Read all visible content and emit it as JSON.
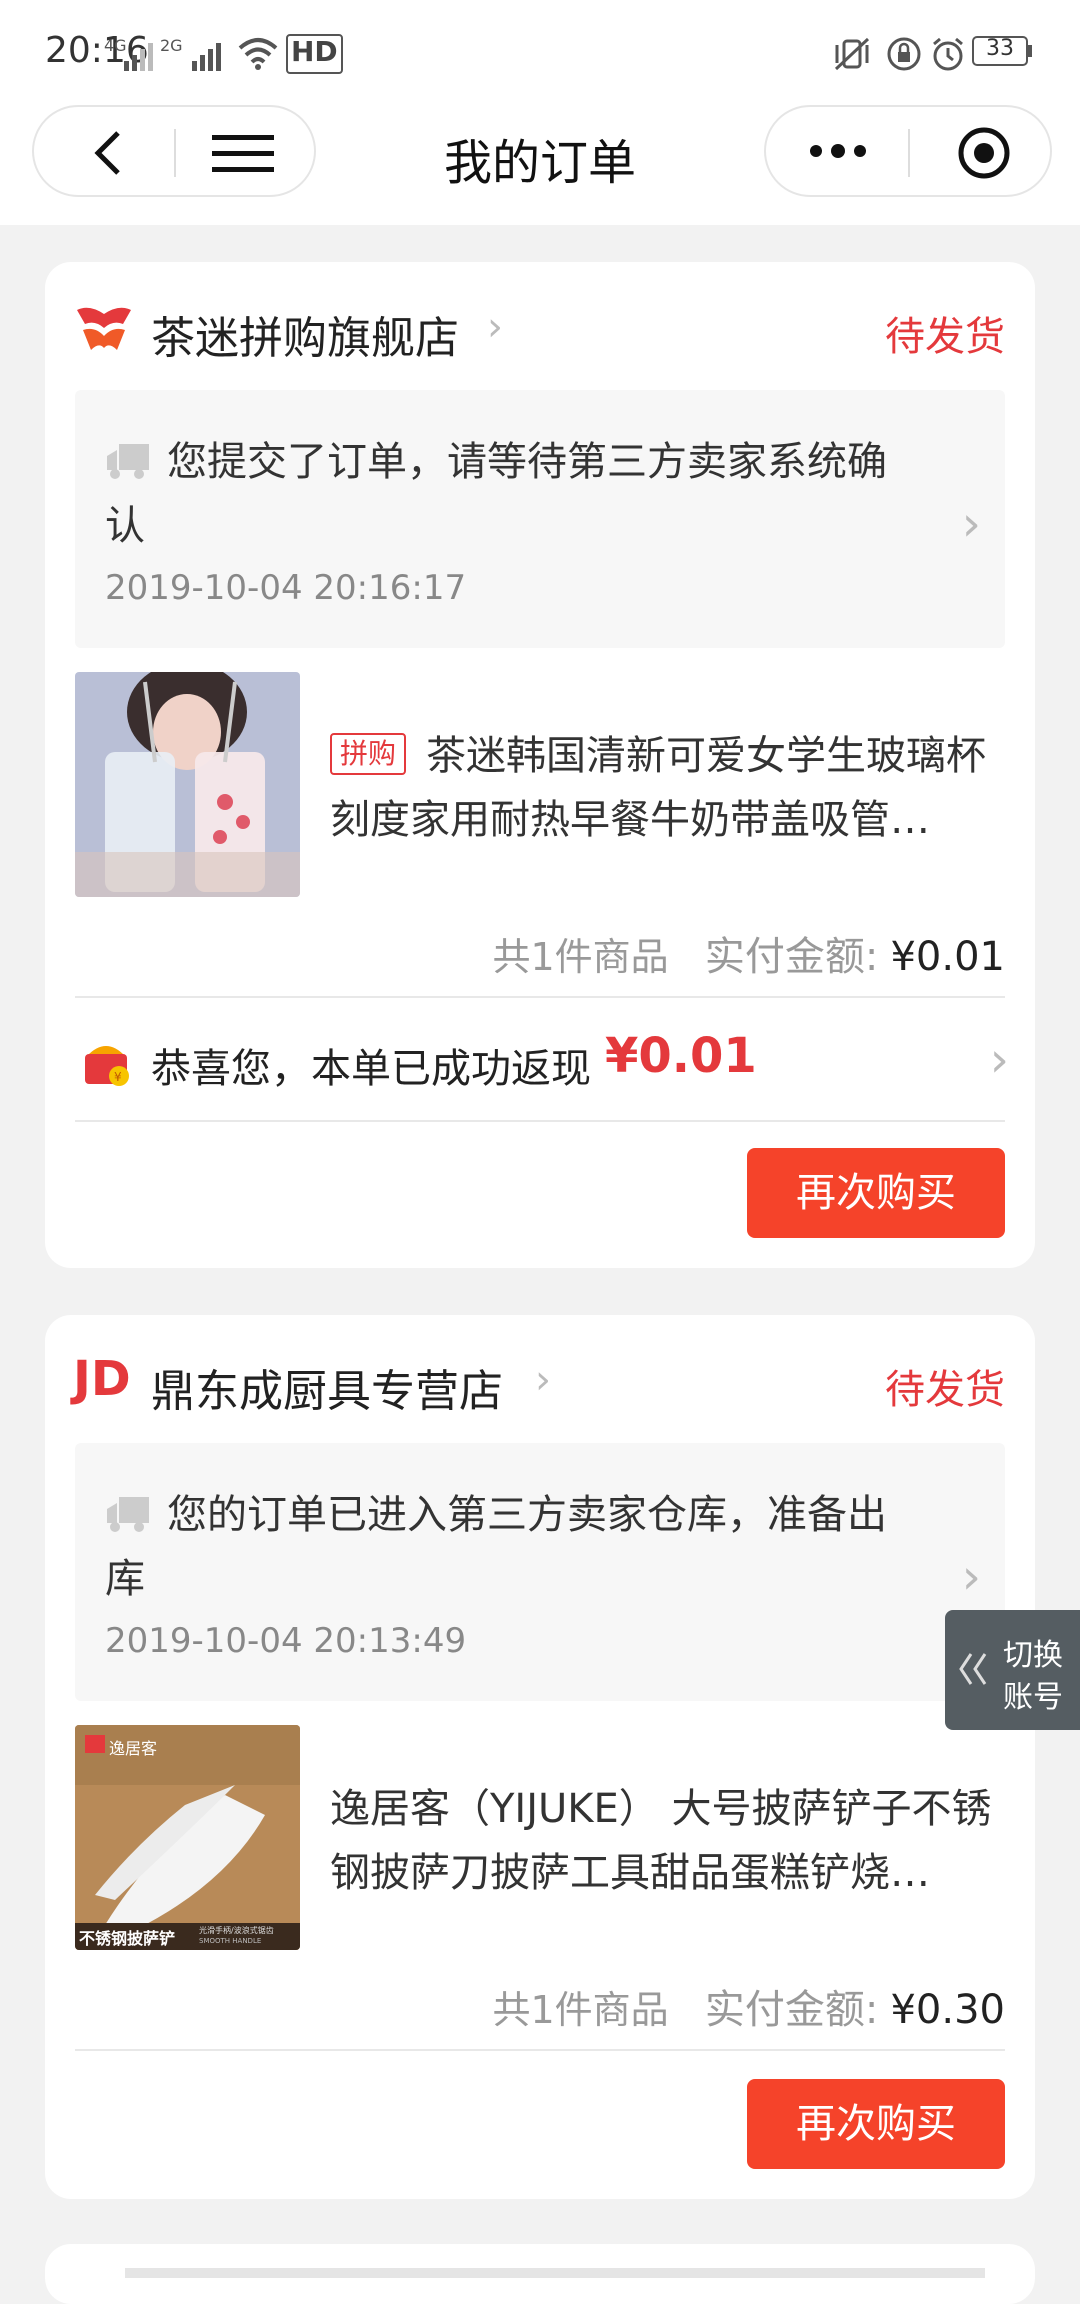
{
  "status_bar": {
    "time": "20:16",
    "network_1": "4G",
    "network_2": "2G",
    "hd_label": "HD",
    "battery": "33"
  },
  "navbar": {
    "title": "我的订单"
  },
  "orders": [
    {
      "store_name": "茶迷拼购旗舰店",
      "status": "待发货",
      "info_text": "您提交了订单，请等待第三方卖家系统确认",
      "info_time": "2019-10-04 20:16:17",
      "tag": "拼购",
      "product_name": "茶迷韩国清新可爱女学生玻璃杯刻度家用耐热早餐牛奶带盖吸管…",
      "count_label": "共1件商品",
      "paid_label": "实付金额:",
      "paid_amount": "¥0.01",
      "cashback_text": "恭喜您，本单已成功返现",
      "cashback_amount": "¥0.01",
      "rebuy_label": "再次购买"
    },
    {
      "store_logo_text": "JD",
      "store_name": "鼎东成厨具专营店",
      "status": "待发货",
      "info_text": "您的订单已进入第三方卖家仓库，准备出库",
      "info_time": "2019-10-04 20:13:49",
      "product_name": "逸居客（YIJUKE） 大号披萨铲子不锈钢披萨刀披萨工具甜品蛋糕铲烧…",
      "thumb_brand": "逸居客",
      "thumb_caption": "不锈钢披萨铲",
      "thumb_subcaption": "光滑手柄/波浪式锯齿",
      "thumb_subcaption_en": "SMOOTH HANDLE",
      "count_label": "共1件商品",
      "paid_label": "实付金额:",
      "paid_amount": "¥0.30",
      "rebuy_label": "再次购买"
    }
  ],
  "switch_account": {
    "line1": "切换",
    "line2": "账号"
  },
  "colors": {
    "accent_red": "#e4393c",
    "button_red": "#f5432a",
    "page_bg": "#f2f2f2"
  }
}
